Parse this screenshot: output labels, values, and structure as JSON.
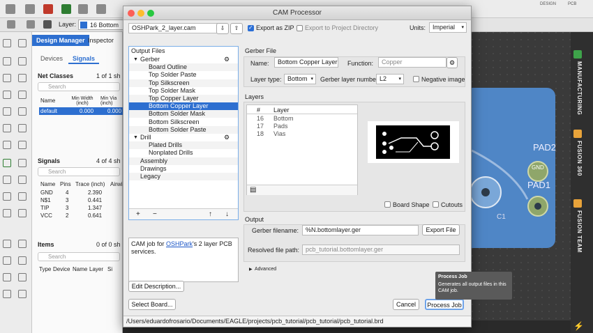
{
  "app": {
    "layer_label": "Layer:",
    "layer_value": "16 Bottom",
    "panel_tabs": [
      "Design Manager",
      "Inspector"
    ],
    "sub_tabs": [
      "Devices",
      "Signals"
    ],
    "net_classes": {
      "title": "Net Classes",
      "count": "1 of 1 sh",
      "search": "Search",
      "headers": [
        "Name",
        "Min Width (inch)",
        "Min Via (inch)"
      ],
      "row": [
        "default",
        "0.000",
        "0.000"
      ]
    },
    "signals": {
      "title": "Signals",
      "count": "4 of 4 sh",
      "search": "Search",
      "headers": [
        "Name",
        "Pins",
        "Trace (inch)",
        "Airwi"
      ],
      "rows": [
        [
          "GND",
          "4",
          "2.390"
        ],
        [
          "N$1",
          "3",
          "0.441"
        ],
        [
          "TIP",
          "3",
          "1.347"
        ],
        [
          "VCC",
          "2",
          "0.641"
        ]
      ]
    },
    "items": {
      "title": "Items",
      "count": "0 of 0 sh",
      "search": "Search",
      "headers": [
        "Type",
        "Device",
        "Name",
        "Layer",
        "Si"
      ]
    },
    "side_labels": [
      "MANUFACTURING",
      "FUSION 360",
      "FUSION TEAM"
    ],
    "canvas_labels": [
      "PAD2",
      "PAD1",
      "GND",
      "C1"
    ],
    "top_right_labels": [
      "DESIGN",
      "PCB"
    ],
    "accent": "#2d6fd0"
  },
  "dialog": {
    "title": "CAM Processor",
    "job_file": "OSHPark_2_layer.cam",
    "export_zip": "Export as ZIP",
    "export_zip_checked": true,
    "export_project": "Export to Project Directory",
    "export_project_checked": false,
    "units_label": "Units:",
    "units_value": "Imperial",
    "output_files_header": "Output Files",
    "tree": [
      {
        "label": "Gerber",
        "level": 0,
        "caret": true
      },
      {
        "label": "Board Outline",
        "level": 1
      },
      {
        "label": "Top Solder Paste",
        "level": 1
      },
      {
        "label": "Top Silkscreen",
        "level": 1
      },
      {
        "label": "Top Solder Mask",
        "level": 1
      },
      {
        "label": "Top Copper Layer",
        "level": 1
      },
      {
        "label": "Bottom Copper Layer",
        "level": 1,
        "selected": true
      },
      {
        "label": "Bottom Solder Mask",
        "level": 1
      },
      {
        "label": "Bottom Silkscreen",
        "level": 1
      },
      {
        "label": "Bottom Solder Paste",
        "level": 1
      },
      {
        "label": "Drill",
        "level": 0,
        "caret": true
      },
      {
        "label": "Plated Drills",
        "level": 1
      },
      {
        "label": "Nonplated Drills",
        "level": 1
      },
      {
        "label": "Assembly",
        "level": 0
      },
      {
        "label": "Drawings",
        "level": 0
      },
      {
        "label": "Legacy",
        "level": 0
      }
    ],
    "tree_buttons": [
      "+",
      "−",
      "↑",
      "↓"
    ],
    "desc_prefix": "CAM job for ",
    "desc_link": "OSHPark",
    "desc_suffix": "'s 2 layer PCB services.",
    "edit_description": "Edit Description...",
    "select_board": "Select Board...",
    "gerber_file_header": "Gerber File",
    "name_label": "Name:",
    "name_value": "Bottom Copper Layer",
    "function_label": "Function:",
    "function_value": "Copper",
    "layer_type_label": "Layer type:",
    "layer_type_value": "Bottom",
    "gerber_layer_label": "Gerber layer numbe",
    "gerber_layer_value": "L2",
    "negative_image": "Negative image",
    "layers_header": "Layers",
    "layers_cols": [
      "#",
      "Layer"
    ],
    "layers_rows": [
      [
        "16",
        "Bottom"
      ],
      [
        "17",
        "Pads"
      ],
      [
        "18",
        "Vias"
      ]
    ],
    "board_shape": "Board Shape",
    "cutouts": "Cutouts",
    "output_header": "Output",
    "gerber_filename_label": "Gerber filename:",
    "gerber_filename_value": "%N.bottomlayer.ger",
    "export_file": "Export File",
    "resolved_label": "Resolved file path:",
    "resolved_value": "pcb_tutorial.bottomlayer.ger",
    "advanced": "Advanced",
    "cancel": "Cancel",
    "process_job": "Process Job",
    "tooltip_title": "Process Job",
    "tooltip_text": "Generates all output files in this CAM job.",
    "status_path": "/Users/eduardofrosario/Documents/EAGLE/projects/pcb_tutorial/pcb_tutorial/pcb_tutorial.brd"
  }
}
